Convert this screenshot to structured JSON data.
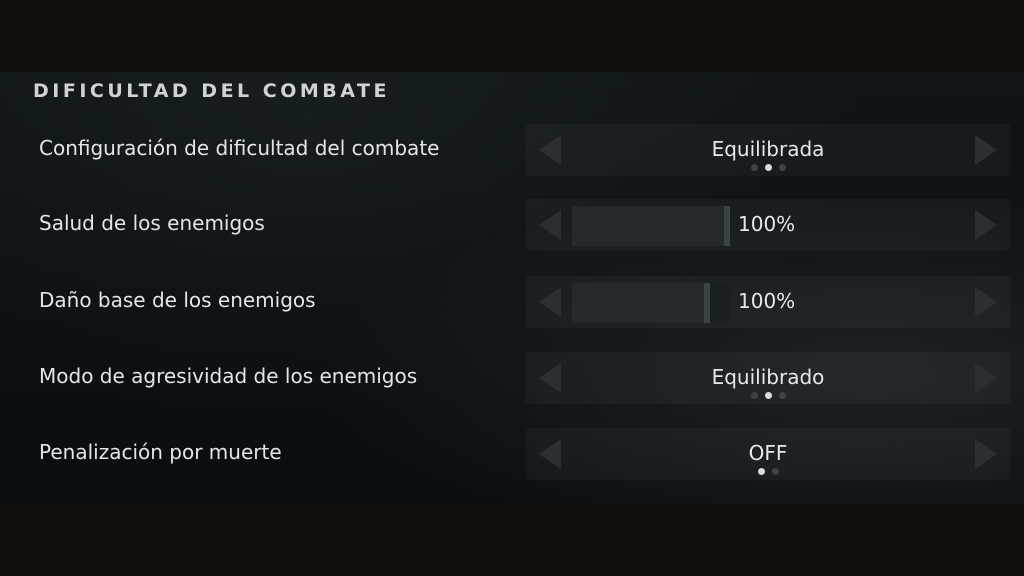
{
  "section": {
    "title": "DIFICULTAD DEL COMBATE"
  },
  "settings": [
    {
      "label": "Configuración de dificultad del combate",
      "type": "selector",
      "value": "Equilibrada",
      "option_count": 3,
      "selected_index": 1
    },
    {
      "label": "Salud de los enemigos",
      "type": "slider",
      "value": "100%",
      "level": 1.0
    },
    {
      "label": "Daño base de los enemigos",
      "type": "slider",
      "value": "100%",
      "level": 0.87
    },
    {
      "label": "Modo de agresividad de los enemigos",
      "type": "selector",
      "value": "Equilibrado",
      "option_count": 3,
      "selected_index": 1
    },
    {
      "label": "Penalización por muerte",
      "type": "selector",
      "value": "OFF",
      "option_count": 2,
      "selected_index": 0
    }
  ],
  "icons": {
    "left": "chevron-left-icon",
    "right": "chevron-right-icon"
  },
  "colors": {
    "panel_bg": "#0f1517",
    "letterbox": "#150f0c",
    "text": "#e4e6e6",
    "dot_active": "#d8dcdc",
    "dot_inactive": "#3e4446",
    "slider_handle": "#3a4446"
  }
}
